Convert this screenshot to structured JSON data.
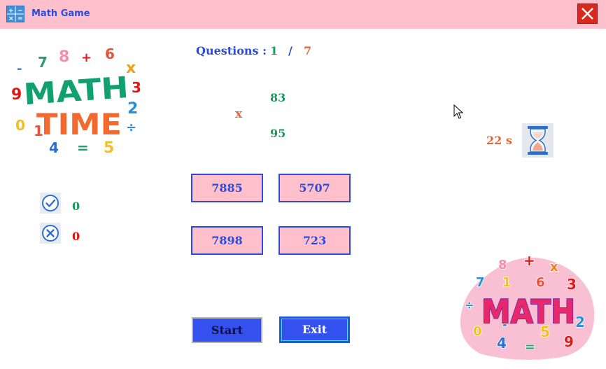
{
  "window": {
    "title": "Math Game",
    "close_icon": "close-icon",
    "app_icon": "calculator-icon"
  },
  "question": {
    "label": "Questions :",
    "current": "1",
    "separator": "/",
    "total": "7"
  },
  "problem": {
    "operand1": "83",
    "operator": "x",
    "operand2": "95"
  },
  "timer": {
    "text": "22 s",
    "icon": "hourglass-icon"
  },
  "answers": [
    "7885",
    "5707",
    "7898",
    "723"
  ],
  "score": {
    "correct": "0",
    "wrong": "0",
    "correct_icon": "check-circle-icon",
    "wrong_icon": "x-circle-icon"
  },
  "buttons": {
    "start": "Start",
    "exit": "Exit"
  },
  "logos": {
    "top_left": {
      "lines": [
        "MATH",
        "TIME"
      ],
      "digits": [
        "-",
        "7",
        "8",
        "+",
        "6",
        "x",
        "3",
        "2",
        "÷",
        "5",
        "=",
        "4",
        "1",
        "0",
        "9"
      ]
    },
    "bottom_right": {
      "word": "MATH",
      "digits": [
        "8",
        "+",
        "x",
        "7",
        "1",
        "6",
        "3",
        "÷",
        "2",
        "0",
        "-",
        "5",
        "4",
        "=",
        "9"
      ]
    }
  },
  "colors": {
    "titlebar": "#ffc0cb",
    "accent_blue": "#2b4bd8",
    "correct_green": "#1a9a5a",
    "orange": "#e8643a",
    "wrong_red": "#e01010",
    "button_blue": "#3451f0"
  }
}
